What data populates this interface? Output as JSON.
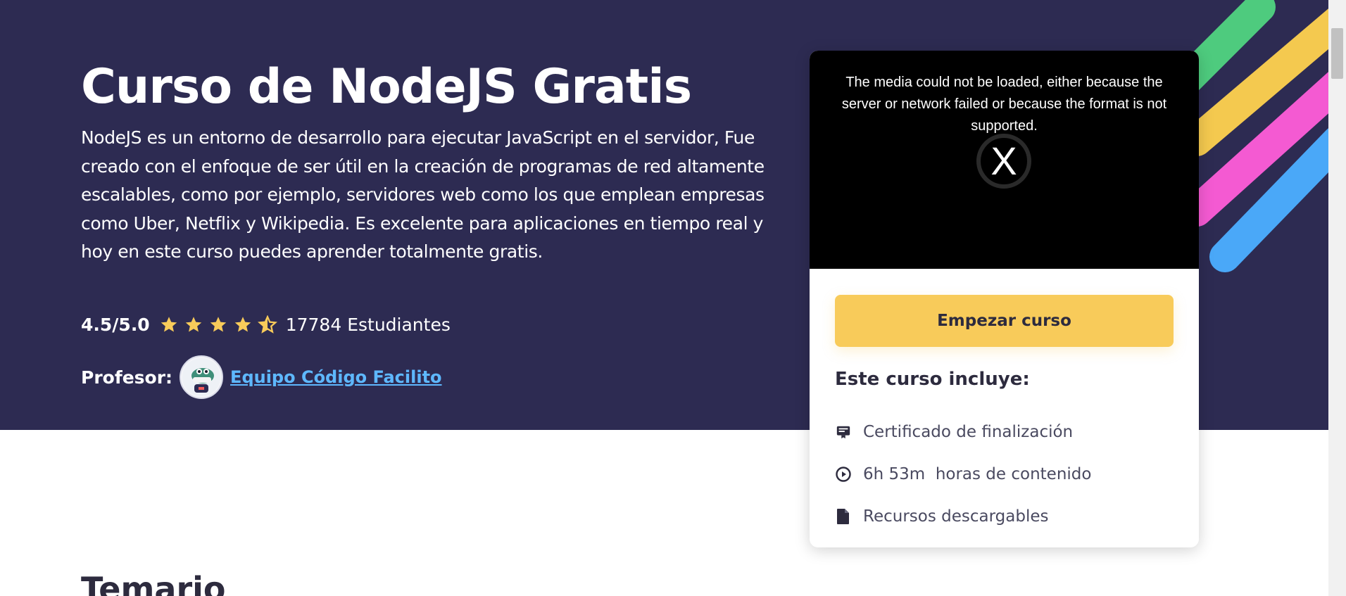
{
  "hero": {
    "title": "Curso de NodeJS Gratis",
    "description": "NodeJS es un entorno de desarrollo para ejecutar JavaScript en el servidor, Fue creado con el enfoque de ser útil en la creación de programas de red altamente escalables, como por ejemplo, servidores web como los que emplean empresas como Uber, Netflix y Wikipedia. Es excelente para aplicaciones en tiempo real y hoy en este curso puedes aprender totalmente gratis.",
    "rating": "4.5/5.0",
    "rating_value": 4.5,
    "rating_max": 5,
    "students": "17784 Estudiantes",
    "teacher_label": "Profesor:",
    "teacher_name": "Equipo Código Facilito"
  },
  "video": {
    "error_message": "The media could not be loaded, either because the server or network failed or because the format is not supported.",
    "error_glyph": "X"
  },
  "card": {
    "cta_label": "Empezar curso",
    "includes_title": "Este curso incluye:",
    "includes": [
      {
        "icon": "certificate-icon",
        "label": "Certificado de finalización"
      },
      {
        "icon": "play-circle-icon",
        "label": "6h 53m  horas de contenido"
      },
      {
        "icon": "file-icon",
        "label": "Recursos descargables"
      }
    ]
  },
  "section": {
    "syllabus_title": "Temario"
  },
  "colors": {
    "hero_bg": "#2d2b52",
    "accent_yellow": "#f8cb5a",
    "link_blue": "#5eb8ff",
    "star_yellow": "#f8cb5a",
    "stripe_green": "#4ecb7e",
    "stripe_yellow": "#f4c94f",
    "stripe_pink": "#f45ad2",
    "stripe_blue": "#4aa8f8"
  }
}
